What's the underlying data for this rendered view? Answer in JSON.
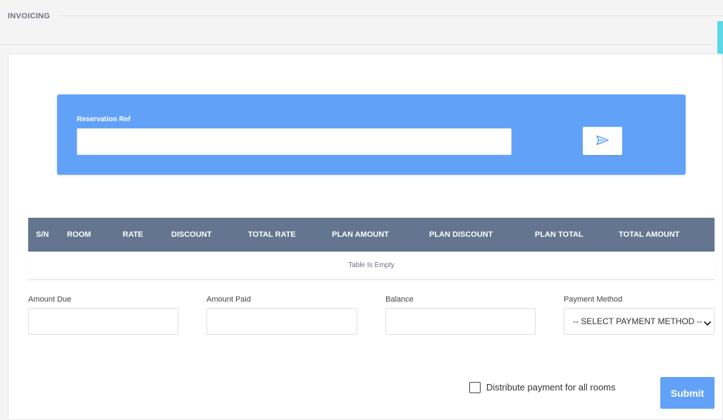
{
  "page": {
    "title": "INVOICING"
  },
  "search": {
    "label": "Reservation Ref",
    "value": "",
    "placeholder": "",
    "submit_icon": "send-icon"
  },
  "table": {
    "headers": [
      "S/N",
      "ROOM",
      "RATE",
      "DISCOUNT",
      "TOTAL RATE",
      "PLAN AMOUNT",
      "PLAN DISCOUNT",
      "PLAN TOTAL",
      "TOTAL AMOUNT"
    ],
    "empty_text": "Table Is Empty"
  },
  "fields": {
    "amount_due": {
      "label": "Amount Due",
      "value": ""
    },
    "amount_paid": {
      "label": "Amount Paid",
      "value": ""
    },
    "balance": {
      "label": "Balance",
      "value": ""
    },
    "payment_method": {
      "label": "Payment Method",
      "selected": "-- SELECT PAYMENT METHOD --"
    }
  },
  "distribute": {
    "label": "Distribute payment for all rooms",
    "checked": false
  },
  "actions": {
    "submit_label": "Submit"
  },
  "colors": {
    "accent": "#61a2f8",
    "table_header": "#63758f",
    "scroll_accent": "#5ad8e8"
  }
}
